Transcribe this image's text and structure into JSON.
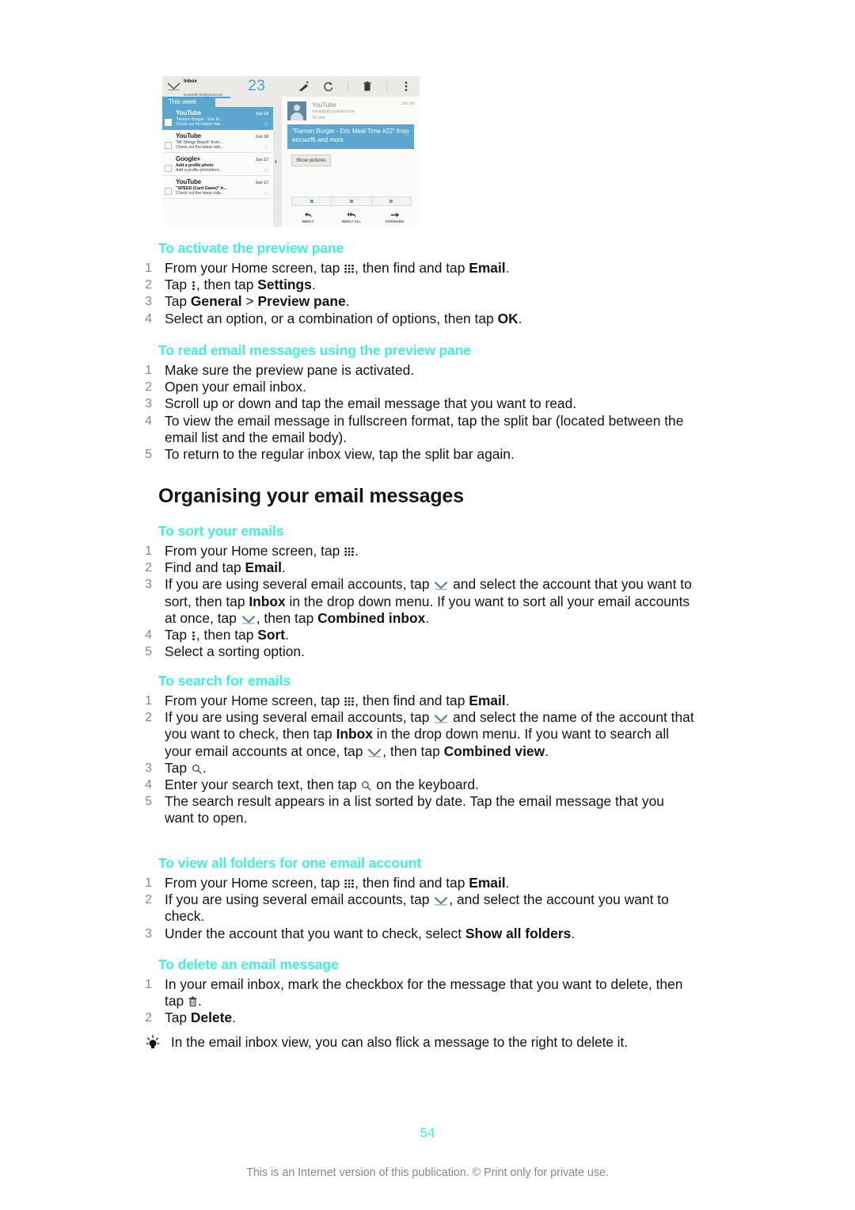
{
  "figure": {
    "name": "email-preview-pane-screenshot",
    "toolbar": {
      "folder": "Inbox",
      "account_email": "tsoseini9726@gmail.com",
      "unread_count": "23",
      "icons": [
        "compose-icon",
        "refresh-icon",
        "delete-icon",
        "overflow-menu-icon"
      ]
    },
    "list": {
      "section_label": "This week",
      "rows": [
        {
          "sender": "YouTube",
          "date": "Jun 19",
          "subject": "\"Ramen Burger - Eric M...",
          "preview": "Check out the latest vide...",
          "selected": true
        },
        {
          "sender": "YouTube",
          "date": "Jun 18",
          "subject": "\"Mr Strings Beach\" from...",
          "preview": "Check out the latest vide...",
          "selected": false
        },
        {
          "sender": "Google+",
          "date": "Jun 17",
          "subject": "Add a profile photo",
          "preview": "Add a profile photoHere...",
          "selected": false
        },
        {
          "sender": "YouTube",
          "date": "Jun 17",
          "subject": "\"SPEED (Card Game)\" fr...",
          "preview": "Check out the latest vide...",
          "selected": false
        }
      ]
    },
    "preview": {
      "from": "YouTube",
      "from_email": "noreply@youtube.com",
      "to": "To: me",
      "date": "Jun 19",
      "subject": "\"Ramen Burger - Eric Meal Time #22\" from ericsurf6 and more",
      "show_pictures": "Show pictures",
      "actions": [
        {
          "label": "REPLY",
          "icon": "reply-icon"
        },
        {
          "label": "REPLY ALL",
          "icon": "reply-all-icon"
        },
        {
          "label": "FORWARD",
          "icon": "forward-icon"
        }
      ]
    }
  },
  "sections": {
    "activate_preview": {
      "heading": "To activate the preview pane",
      "steps": [
        "From your Home screen, tap |GRID|, then find and tap <b>Email</b>.",
        "Tap |DOTS|, then tap <b>Settings</b>.",
        "Tap <b>General</b> &gt; <b>Preview pane</b>.",
        "Select an option, or a combination of options, then tap <b>OK</b>."
      ]
    },
    "read_preview": {
      "heading": "To read email messages using the preview pane",
      "steps": [
        "Make sure the preview pane is activated.",
        "Open your email inbox.",
        "Scroll up or down and tap the email message that you want to read.",
        "To view the email message in fullscreen format, tap the split bar (located between the email list and the email body).",
        "To return to the regular inbox view, tap the split bar again."
      ]
    },
    "organising": {
      "heading": "Organising your email messages"
    },
    "sort": {
      "heading": "To sort your emails",
      "steps": [
        "From your Home screen, tap |GRID|.",
        "Find and tap <b>Email</b>.",
        "If you are using several email accounts, tap |ENV| and select the account that you want to sort, then tap <b>Inbox</b> in the drop down menu. If you want to sort all your email accounts at once, tap |ENV|, then tap <b>Combined inbox</b>.",
        "Tap |DOTS|, then tap <b>Sort</b>.",
        "Select a sorting option."
      ]
    },
    "search": {
      "heading": "To search for emails",
      "steps": [
        "From your Home screen, tap |GRID|, then find and tap <b>Email</b>.",
        "If you are using several email accounts, tap |ENV| and select the name of the account that you want to check, then tap <b>Inbox</b> in the drop down menu. If you want to search all your email accounts at once, tap |ENV|, then tap <b>Combined view</b>.",
        "Tap |SEARCH|.",
        "Enter your search text, then tap |SEARCH| on the keyboard.",
        "The search result appears in a list sorted by date. Tap the email message that you want to open."
      ]
    },
    "folders": {
      "heading": "To view all folders for one email account",
      "steps": [
        "From your Home screen, tap |GRID|, then find and tap <b>Email</b>.",
        "If you are using several email accounts, tap |ENV|, and select the account you want to check.",
        "Under the account that you want to check, select <b>Show all folders</b>."
      ]
    },
    "delete": {
      "heading": "To delete an email message",
      "steps": [
        "In your email inbox, mark the checkbox for the message that you want to delete, then tap |TRASH|.",
        "Tap <b>Delete</b>."
      ],
      "tip": "In the email inbox view, you can also flick a message to the right to delete it."
    }
  },
  "footer": {
    "page_number": "54",
    "note": "This is an Internet version of this publication. © Print only for private use."
  },
  "colors": {
    "accent_cyan": "#41f0d7",
    "ui_blue": "#5ba7d0",
    "body_text": "#141414",
    "step_number": "#878787",
    "footer_text": "#888888"
  }
}
